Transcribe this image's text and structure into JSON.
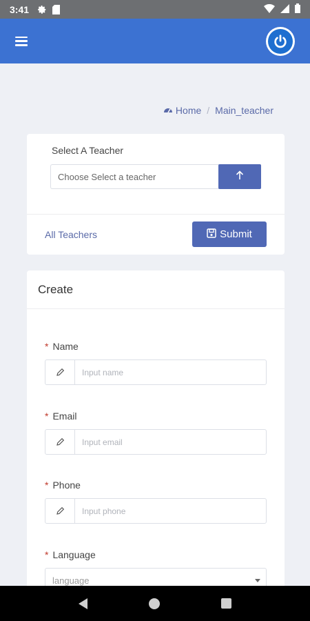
{
  "status_bar": {
    "time": "3:41"
  },
  "breadcrumb": {
    "home": "Home",
    "separator": "/",
    "current": "Main_teacher"
  },
  "select_card": {
    "label": "Select A Teacher",
    "select_placeholder": "Choose Select a teacher",
    "all_teachers_link": "All Teachers",
    "submit_label": "Submit"
  },
  "create_card": {
    "title": "Create",
    "fields": [
      {
        "label": "Name",
        "placeholder": "Input name"
      },
      {
        "label": "Email",
        "placeholder": "Input email"
      },
      {
        "label": "Phone",
        "placeholder": "Input phone"
      },
      {
        "label": "Language",
        "placeholder": "language"
      }
    ],
    "required_mark": "*"
  },
  "colors": {
    "appbar": "#3c72d2",
    "primary_button": "#5068b5",
    "link": "#5a6aa8",
    "required": "#c0392b"
  }
}
